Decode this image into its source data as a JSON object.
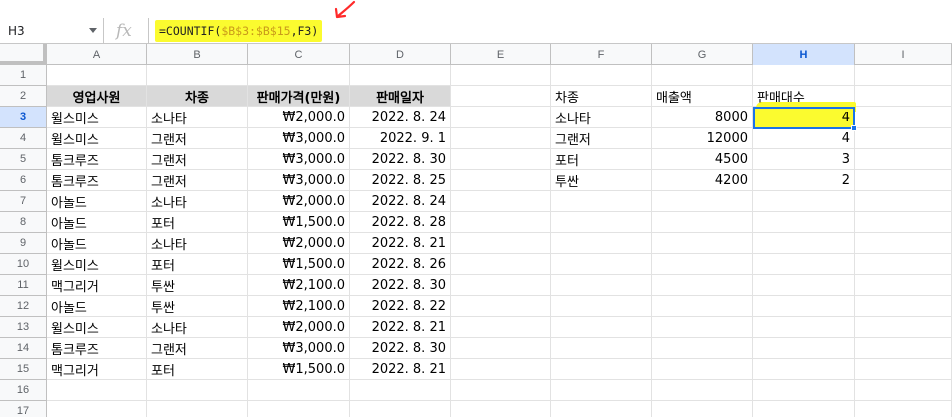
{
  "formula_bar": {
    "name_box": "H3",
    "fx_label": "fx",
    "formula_prefix": "=COUNTIF(",
    "formula_range": "$B$3:$B$15",
    "formula_suffix": ",F3)"
  },
  "colors": {
    "highlight": "#fbfb2f",
    "selection": "#1a73e8",
    "header_fill": "#d9d9d9",
    "annotation_arrow": "#ff2a2a"
  },
  "columns": [
    "A",
    "B",
    "C",
    "D",
    "E",
    "F",
    "G",
    "H",
    "I"
  ],
  "rows": [
    "1",
    "2",
    "3",
    "4",
    "5",
    "6",
    "7",
    "8",
    "9",
    "10",
    "11",
    "12",
    "13",
    "14",
    "15",
    "16",
    "17"
  ],
  "sales_table": {
    "headers": [
      "영업사원",
      "차종",
      "판매가격(만원)",
      "판매일자"
    ],
    "rows": [
      [
        "윌스미스",
        "소나타",
        "₩2,000.0",
        "2022. 8. 24"
      ],
      [
        "윌스미스",
        "그랜저",
        "₩3,000.0",
        "2022. 9. 1"
      ],
      [
        "톰크루즈",
        "그랜저",
        "₩3,000.0",
        "2022. 8. 30"
      ],
      [
        "톰크루즈",
        "그랜저",
        "₩3,000.0",
        "2022. 8. 25"
      ],
      [
        "아놀드",
        "소나타",
        "₩2,000.0",
        "2022. 8. 24"
      ],
      [
        "아놀드",
        "포터",
        "₩1,500.0",
        "2022. 8. 28"
      ],
      [
        "아놀드",
        "소나타",
        "₩2,000.0",
        "2022. 8. 21"
      ],
      [
        "윌스미스",
        "포터",
        "₩1,500.0",
        "2022. 8. 26"
      ],
      [
        "맥그리거",
        "투싼",
        "₩2,100.0",
        "2022. 8. 30"
      ],
      [
        "아놀드",
        "투싼",
        "₩2,100.0",
        "2022. 8. 22"
      ],
      [
        "윌스미스",
        "소나타",
        "₩2,000.0",
        "2022. 8. 21"
      ],
      [
        "톰크루즈",
        "그랜저",
        "₩3,000.0",
        "2022. 8. 30"
      ],
      [
        "맥그리거",
        "포터",
        "₩1,500.0",
        "2022. 8. 21"
      ]
    ]
  },
  "summary_table": {
    "headers": [
      "차종",
      "매출액",
      "판매대수"
    ],
    "rows": [
      [
        "소나타",
        "8000",
        "4"
      ],
      [
        "그랜저",
        "12000",
        "4"
      ],
      [
        "포터",
        "4500",
        "3"
      ],
      [
        "투싼",
        "4200",
        "2"
      ]
    ]
  }
}
